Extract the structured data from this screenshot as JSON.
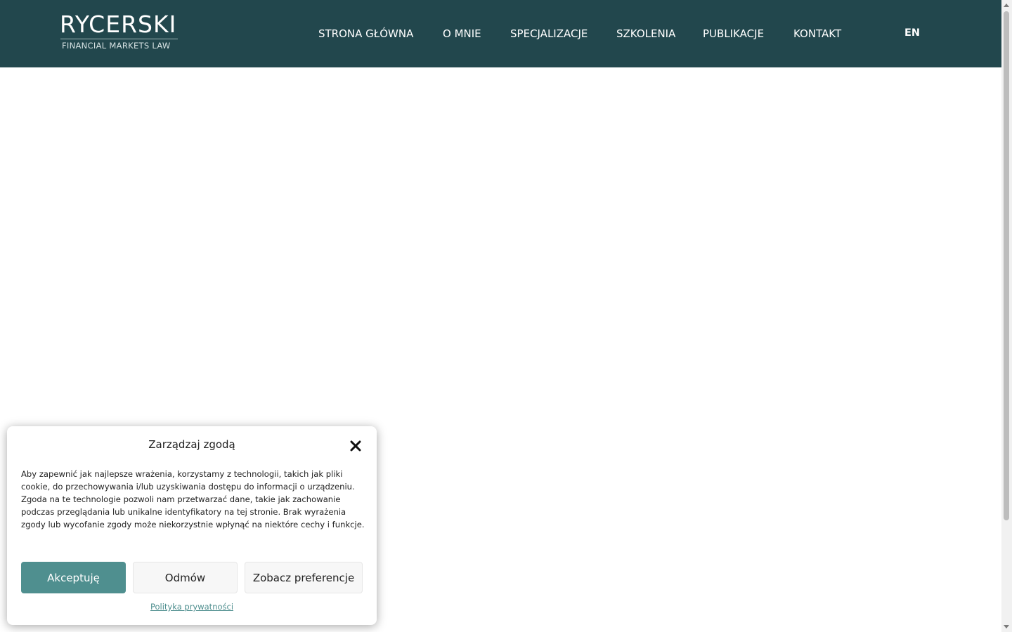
{
  "header": {
    "logo": {
      "name": "RYCERSKI",
      "tagline": "FINANCIAL MARKETS LAW"
    },
    "nav": [
      {
        "label": "STRONA GŁÓWNA"
      },
      {
        "label": "O MNIE"
      },
      {
        "label": "SPECJALIZACJE"
      },
      {
        "label": "SZKOLENIA"
      },
      {
        "label": "PUBLIKACJE"
      },
      {
        "label": "KONTAKT"
      }
    ],
    "language": "EN"
  },
  "cookie_banner": {
    "title": "Zarządzaj zgodą",
    "text": "Aby zapewnić jak najlepsze wrażenia, korzystamy z technologii, takich jak pliki cookie, do przechowywania i/lub uzyskiwania dostępu do informacji o urządzeniu. Zgoda na te technologie pozwoli nam przetwarzać dane, takie jak zachowanie podczas przeglądania lub unikalne identyfikatory na tej stronie. Brak wyrażenia zgody lub wycofanie zgody może niekorzystnie wpłynąć na niektóre cechy i funkcje.",
    "accept_label": "Akceptuję",
    "deny_label": "Odmów",
    "preferences_label": "Zobacz preferencje",
    "privacy_link": "Polityka prywatności",
    "close_icon": "close-x-icon"
  },
  "colors": {
    "header_bg": "#22474d",
    "accent": "#4f8f8f"
  }
}
